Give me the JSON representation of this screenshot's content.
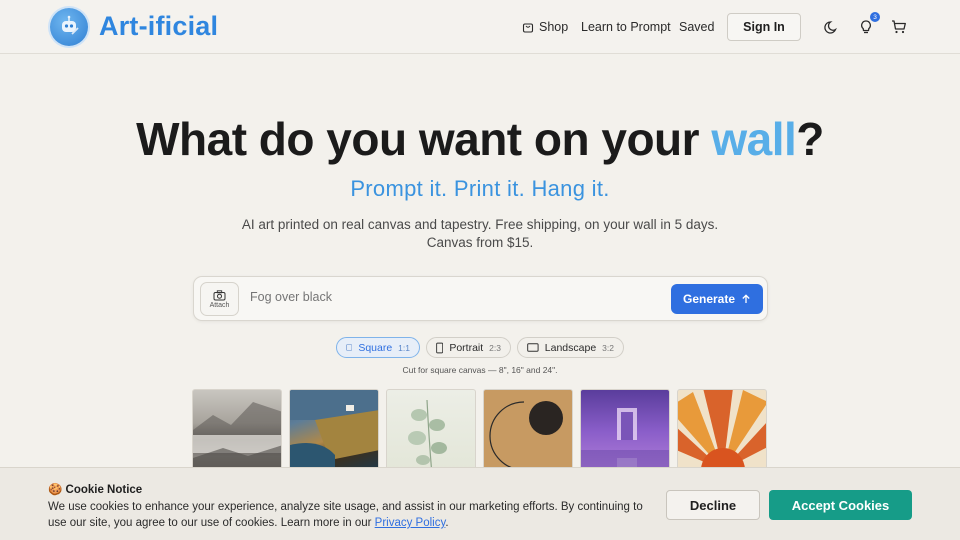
{
  "header": {
    "brand": "Art-ificial",
    "nav": {
      "shop": "Shop",
      "learn": "Learn to Prompt",
      "saved": "Saved"
    },
    "sign_in": "Sign In",
    "badge_count": "3",
    "icons": [
      "robot-logo-icon",
      "bag-icon",
      "moon-icon",
      "lightbulb-icon",
      "cart-icon"
    ]
  },
  "hero": {
    "title_pre": "What do you want on your ",
    "title_accent": "wall",
    "title_post": "?",
    "tagline": "Prompt it. Print it. Hang it.",
    "desc_line1": "AI art printed on real canvas and tapestry. Free shipping, on your wall in 5 days.",
    "desc_line2": "Canvas from $15."
  },
  "prompt": {
    "attach_label": "Attach",
    "placeholder": "Fog over black",
    "generate_label": "Generate"
  },
  "ratios": [
    {
      "label": "Square",
      "ratio": "1:1",
      "selected": true
    },
    {
      "label": "Portrait",
      "ratio": "2:3",
      "selected": false
    },
    {
      "label": "Landscape",
      "ratio": "3:2",
      "selected": false
    }
  ],
  "cut_note": "Cut for square canvas — 8\", 16\" and 24\".",
  "cookie": {
    "title": "🍪 Cookie Notice",
    "text": "We use cookies to enhance your experience, analyze site usage, and assist in our marketing efforts. By continuing to use our site, you agree to our use of cookies. Learn more in our ",
    "link": "Privacy Policy",
    "text_end": ".",
    "decline": "Decline",
    "accept": "Accept Cookies"
  },
  "colors": {
    "brand": "#2f86df",
    "accent_blue": "#2f6fe0",
    "accept_teal": "#169c88"
  }
}
